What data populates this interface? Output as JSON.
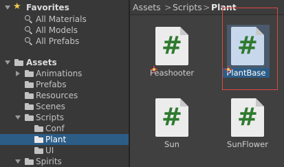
{
  "tree": {
    "favorites": {
      "label": "Favorites",
      "items": [
        "All Materials",
        "All Models",
        "All Prefabs"
      ]
    },
    "assets": {
      "label": "Assets",
      "children": [
        "Animations",
        "Prefabs",
        "Resources",
        "Scenes",
        "Scripts",
        "Conf",
        "Plant",
        "UI",
        "Spirits"
      ]
    }
  },
  "breadcrumb": {
    "items": [
      "Assets",
      "Scripts",
      "Plant"
    ],
    "separator": ">"
  },
  "assets_grid": {
    "items": [
      {
        "name": "Peashooter",
        "icon": "csharp-script-icon"
      },
      {
        "name": "PlantBase",
        "icon": "csharp-script-icon",
        "selected": true
      },
      {
        "name": "Sun",
        "icon": "csharp-script-icon"
      },
      {
        "name": "SunFlower",
        "icon": "csharp-script-icon"
      }
    ],
    "glyph": "#"
  },
  "colors": {
    "selection": "#2c5d87",
    "highlight_box": "#e04848",
    "script_hash": "#2f7a2f",
    "star": "#f2c94c"
  }
}
